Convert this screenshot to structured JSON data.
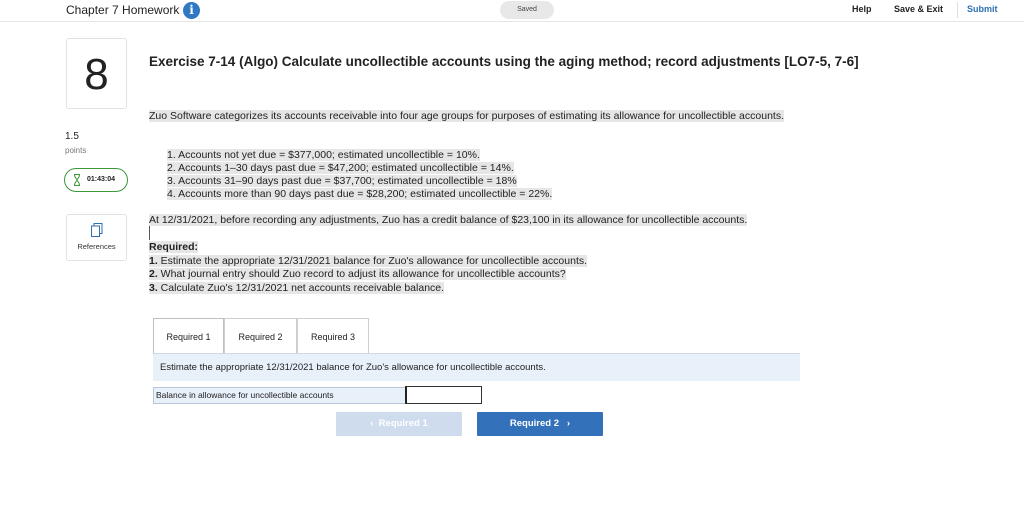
{
  "header": {
    "title": "Chapter 7 Homework",
    "info_icon": "i",
    "status": "Saved",
    "help": "Help",
    "save_exit": "Save & Exit",
    "submit": "Submit"
  },
  "question": {
    "number": "8",
    "points_value": "1.5",
    "points_label": "points",
    "timer": "01:43:04",
    "references_label": "References"
  },
  "exercise": {
    "title": "Exercise 7-14 (Algo) Calculate uncollectible accounts using the aging method; record adjustments [LO7-5, 7-6]",
    "intro": "Zuo Software categorizes its accounts receivable into four age groups for purposes of estimating its allowance for uncollectible accounts.",
    "items": [
      "1. Accounts not yet due = $377,000; estimated uncollectible = 10%.",
      "2. Accounts 1–30 days past due = $47,200; estimated uncollectible = 14%.",
      "3. Accounts 31–90 days past due = $37,700; estimated uncollectible = 18%",
      "4. Accounts more than 90 days past due = $28,200; estimated uncollectible = 22%."
    ],
    "balance_text": "At 12/31/2021, before recording any adjustments, Zuo has a credit balance of $23,100 in its allowance for uncollectible accounts.",
    "required_heading": "Required:",
    "required": [
      {
        "num": "1.",
        "text": " Estimate the appropriate 12/31/2021 balance for Zuo's allowance for uncollectible accounts."
      },
      {
        "num": "2.",
        "text": " What journal entry should Zuo record to adjust its allowance for uncollectible accounts?"
      },
      {
        "num": "3.",
        "text": " Calculate Zuo's 12/31/2021 net accounts receivable balance."
      }
    ]
  },
  "tabs": [
    "Required 1",
    "Required 2",
    "Required 3"
  ],
  "panel": {
    "task": "Estimate the appropriate 12/31/2021 balance for Zuo's allowance for uncollectible accounts.",
    "row_label": "Balance in allowance for uncollectible accounts",
    "row_value": ""
  },
  "nav": {
    "prev_label": "Required 1",
    "next_label": "Required 2",
    "prev_chevron": "‹",
    "next_chevron": "›"
  },
  "colors": {
    "accent": "#3372bb",
    "timer_border": "#3a9a3a",
    "info_icon": "#2f78c4"
  }
}
